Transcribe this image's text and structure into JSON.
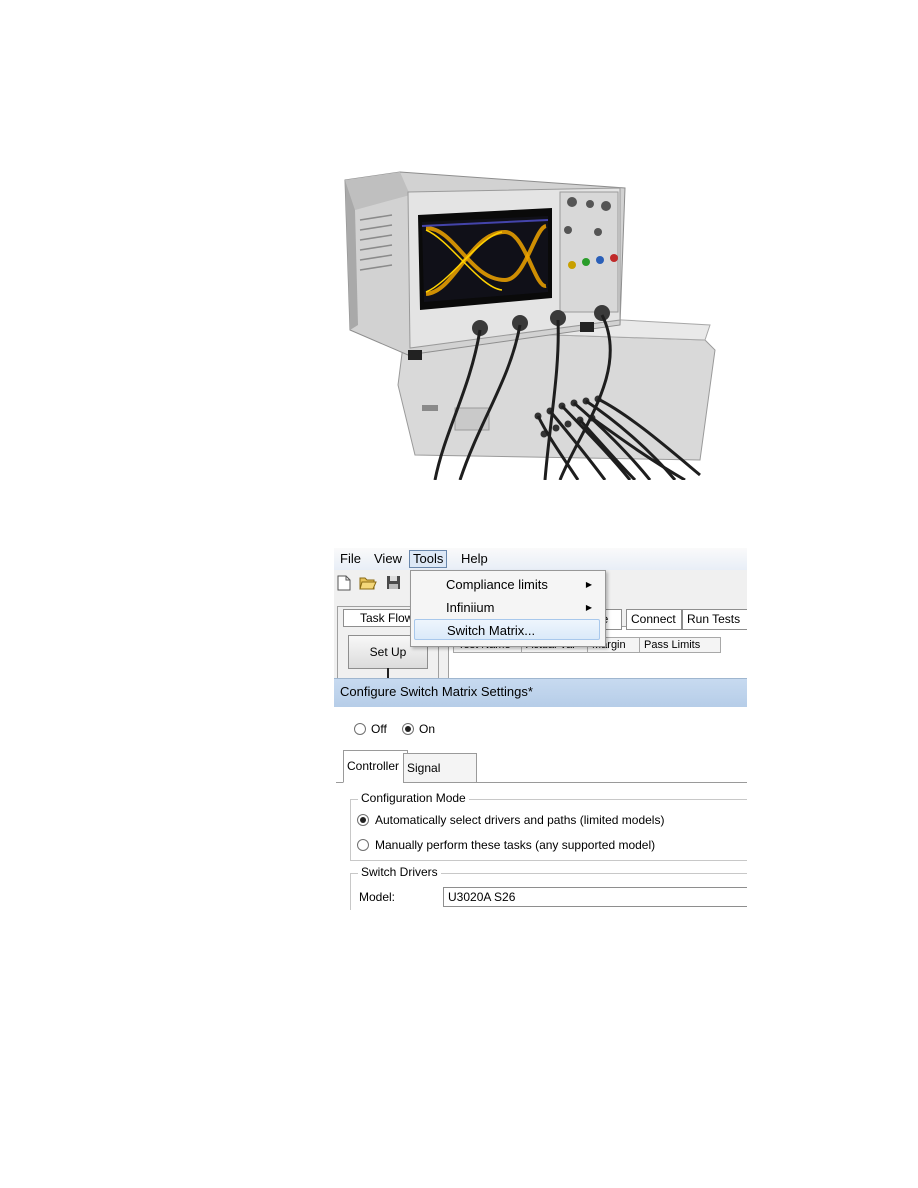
{
  "menubar": {
    "file": "File",
    "view": "View",
    "tools": "Tools",
    "help": "Help"
  },
  "tools_menu": {
    "items": [
      {
        "label": "Compliance limits",
        "submenu": true
      },
      {
        "label": "Infiniium",
        "submenu": true
      },
      {
        "label": "Switch Matrix...",
        "submenu": false
      }
    ]
  },
  "task_flow": {
    "header": "Task Flow",
    "setup_button": "Set Up"
  },
  "main_tabs": [
    "ure",
    "Connect",
    "Run Tests"
  ],
  "results_columns": [
    "Test Name",
    "Actual Val",
    "Margin",
    "Pass Limits"
  ],
  "dialog": {
    "title": "Configure Switch Matrix Settings*",
    "power": {
      "off_label": "Off",
      "on_label": "On",
      "selected": "On"
    },
    "tabs": [
      "Controller",
      "Signal Paths"
    ],
    "configuration_mode": {
      "title": "Configuration Mode",
      "options": [
        "Automatically select drivers and paths (limited models)",
        "Manually perform these tasks (any supported model)"
      ],
      "selected_index": 0
    },
    "switch_drivers": {
      "title": "Switch Drivers",
      "model_label": "Model:",
      "model_value": "U3020A S26"
    }
  },
  "colors": {
    "menu_highlight": "#dde8f6",
    "dialog_title_bar": "#c7daf0",
    "eye_diagram": "#f0a500"
  }
}
